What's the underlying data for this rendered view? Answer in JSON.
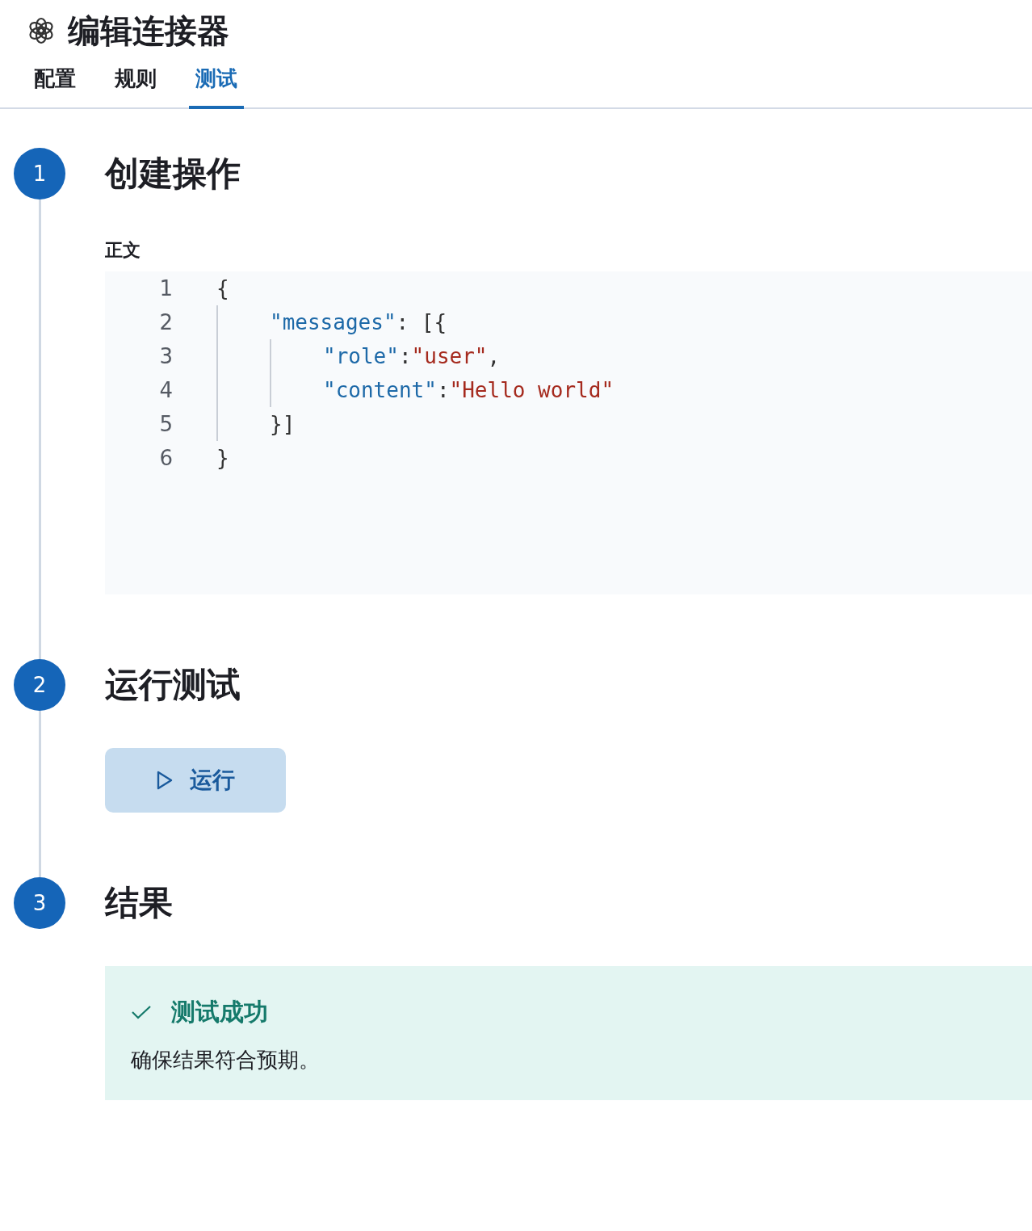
{
  "header": {
    "title": "编辑连接器"
  },
  "tabs": [
    {
      "label": "配置",
      "selected": false
    },
    {
      "label": "规则",
      "selected": false
    },
    {
      "label": "测试",
      "selected": true
    }
  ],
  "steps": [
    {
      "number": "1",
      "title": "创建操作",
      "kind": "editor",
      "field_label": "正文",
      "code": [
        {
          "number": "1",
          "tokens": [
            {
              "kind": "punct",
              "text": "{"
            }
          ],
          "children": [
            {
              "number": "2",
              "tokens": [
                {
                  "kind": "key",
                  "text": "\"messages\""
                },
                {
                  "kind": "punct",
                  "text": ": [{"
                }
              ],
              "children": [
                {
                  "number": "3",
                  "tokens": [
                    {
                      "kind": "key",
                      "text": "\"role\""
                    },
                    {
                      "kind": "punct",
                      "text": ":"
                    },
                    {
                      "kind": "string",
                      "text": "\"user\""
                    },
                    {
                      "kind": "punct",
                      "text": ","
                    }
                  ]
                },
                {
                  "number": "4",
                  "tokens": [
                    {
                      "kind": "key",
                      "text": "\"content\""
                    },
                    {
                      "kind": "punct",
                      "text": ":"
                    },
                    {
                      "kind": "string",
                      "text": "\"Hello world\""
                    }
                  ]
                }
              ]
            },
            {
              "number": "5",
              "tokens": [
                {
                  "kind": "punct",
                  "text": "}]"
                }
              ]
            }
          ]
        },
        {
          "number": "6",
          "tokens": [
            {
              "kind": "punct",
              "text": "}"
            }
          ]
        }
      ]
    },
    {
      "number": "2",
      "title": "运行测试",
      "kind": "button",
      "button": "运行"
    },
    {
      "number": "3",
      "title": "结果",
      "kind": "callout",
      "callout": {
        "title": "测试成功",
        "text": "确保结果符合预期。"
      }
    }
  ]
}
